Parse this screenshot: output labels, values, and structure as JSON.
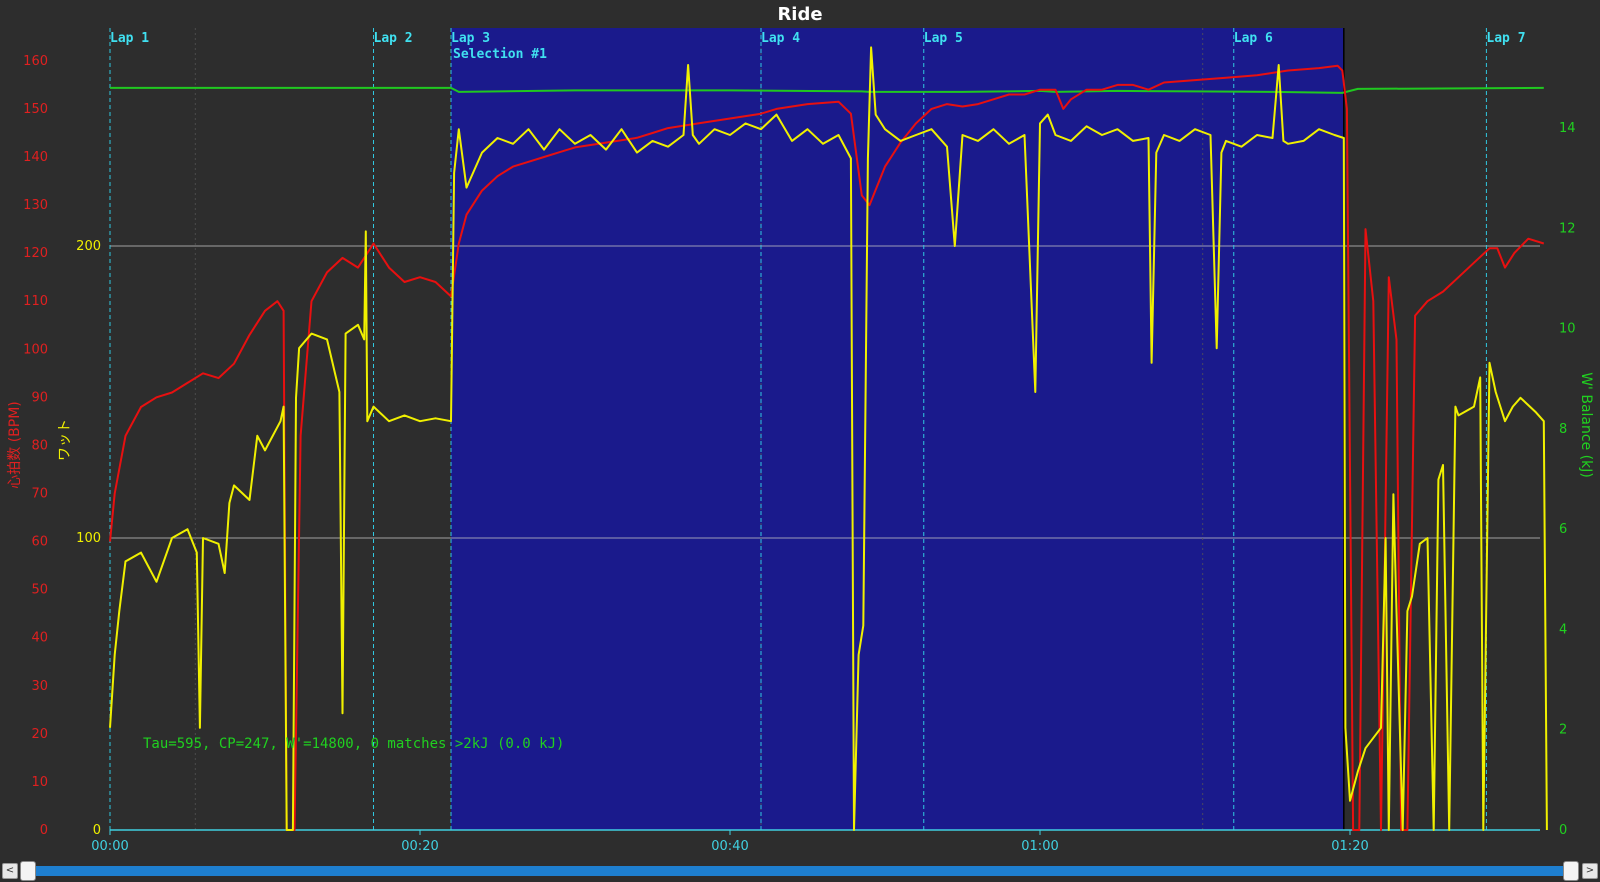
{
  "chart_data": {
    "type": "line",
    "title": "Ride",
    "left_axes": [
      {
        "name": "心拍数 (BPM)",
        "color": "#e02020",
        "ticks": [
          0,
          10,
          20,
          30,
          40,
          50,
          60,
          70,
          80,
          90,
          100,
          110,
          120,
          130,
          140,
          150,
          160
        ],
        "range": [
          0,
          166
        ]
      },
      {
        "name": "ワット",
        "color": "#f0f000",
        "ticks": [
          0,
          100,
          200
        ],
        "range": [
          0,
          275
        ]
      }
    ],
    "right_axis": {
      "name": "W' Balance (kJ)",
      "color": "#20d020",
      "ticks": [
        0,
        2,
        4,
        6,
        8,
        10,
        12,
        14
      ],
      "range": [
        0,
        15.2
      ]
    },
    "x_axis": {
      "ticks": [
        "00:00",
        "00:20",
        "00:40",
        "01:00",
        "01:20"
      ],
      "range_minutes": [
        0,
        92.5
      ]
    },
    "laps": [
      {
        "label": "Lap 1",
        "t": 0
      },
      {
        "label": "Lap 2",
        "t": 17
      },
      {
        "label": "Lap 3",
        "t": 22
      },
      {
        "label": "Lap 4",
        "t": 42
      },
      {
        "label": "Lap 5",
        "t": 52.5
      },
      {
        "label": "Lap 6",
        "t": 72.5
      },
      {
        "label": "Lap 7",
        "t": 88.8
      }
    ],
    "selection": {
      "label": "Selection #1",
      "start": 22,
      "end": 79.6
    },
    "annotation": "Tau=595, CP=247, W'=14800, 0 matches >2kJ (0.0 kJ)",
    "grid": "horizontal lines at 100 W and 200 W",
    "series": [
      {
        "name": "心拍数",
        "color": "#e81010",
        "axis": "hr",
        "points": [
          [
            0,
            60
          ],
          [
            0.3,
            70
          ],
          [
            1,
            82
          ],
          [
            2,
            88
          ],
          [
            3,
            90
          ],
          [
            4,
            91
          ],
          [
            5,
            93
          ],
          [
            6,
            95
          ],
          [
            7,
            94
          ],
          [
            8,
            97
          ],
          [
            9,
            103
          ],
          [
            10,
            108
          ],
          [
            10.8,
            110
          ],
          [
            11.2,
            108
          ],
          [
            11.4,
            0
          ],
          [
            11.9,
            0
          ],
          [
            12.3,
            82
          ],
          [
            13,
            110
          ],
          [
            14,
            116
          ],
          [
            15,
            119
          ],
          [
            16,
            117
          ],
          [
            17,
            122
          ],
          [
            18,
            117
          ],
          [
            19,
            114
          ],
          [
            20,
            115
          ],
          [
            21,
            114
          ],
          [
            22,
            111
          ],
          [
            22.5,
            122
          ],
          [
            23,
            128
          ],
          [
            24,
            133
          ],
          [
            25,
            136
          ],
          [
            26,
            138
          ],
          [
            27,
            139
          ],
          [
            28,
            140
          ],
          [
            29,
            141
          ],
          [
            30,
            142
          ],
          [
            32,
            143
          ],
          [
            34,
            144
          ],
          [
            35,
            145
          ],
          [
            36,
            146
          ],
          [
            38,
            147
          ],
          [
            40,
            148
          ],
          [
            42,
            149
          ],
          [
            43,
            150
          ],
          [
            45,
            151
          ],
          [
            47,
            151.5
          ],
          [
            47.8,
            149
          ],
          [
            48.5,
            132
          ],
          [
            49,
            130
          ],
          [
            50,
            138
          ],
          [
            51,
            143
          ],
          [
            52,
            147
          ],
          [
            53,
            150
          ],
          [
            54,
            151
          ],
          [
            55,
            150.5
          ],
          [
            56,
            151
          ],
          [
            57,
            152
          ],
          [
            58,
            153
          ],
          [
            59,
            153
          ],
          [
            60,
            154
          ],
          [
            61,
            154
          ],
          [
            61.5,
            150
          ],
          [
            62,
            152
          ],
          [
            63,
            154
          ],
          [
            64,
            154
          ],
          [
            65,
            155
          ],
          [
            66,
            155
          ],
          [
            67,
            154
          ],
          [
            68,
            155.5
          ],
          [
            70,
            156
          ],
          [
            72,
            156.5
          ],
          [
            74,
            157
          ],
          [
            76,
            158
          ],
          [
            78,
            158.5
          ],
          [
            79.2,
            159
          ],
          [
            79.5,
            158
          ],
          [
            79.8,
            150
          ],
          [
            80.2,
            0
          ],
          [
            80.6,
            0
          ],
          [
            81,
            125
          ],
          [
            81.5,
            110
          ],
          [
            82,
            0
          ],
          [
            82.5,
            115
          ],
          [
            83,
            102
          ],
          [
            83.3,
            0
          ],
          [
            83.7,
            0
          ],
          [
            84.2,
            107
          ],
          [
            85,
            110
          ],
          [
            86,
            112
          ],
          [
            87,
            115
          ],
          [
            88,
            118
          ],
          [
            89,
            121
          ],
          [
            89.5,
            121
          ],
          [
            90,
            117
          ],
          [
            90.6,
            120
          ],
          [
            91.5,
            123
          ],
          [
            92.5,
            122
          ]
        ]
      },
      {
        "name": "ワット",
        "color": "#f0f000",
        "axis": "w",
        "points": [
          [
            0,
            35
          ],
          [
            0.3,
            60
          ],
          [
            0.6,
            75
          ],
          [
            1,
            92
          ],
          [
            2,
            95
          ],
          [
            3,
            85
          ],
          [
            4,
            100
          ],
          [
            5,
            103
          ],
          [
            5.6,
            95
          ],
          [
            5.8,
            35
          ],
          [
            6,
            100
          ],
          [
            7,
            98
          ],
          [
            7.4,
            88
          ],
          [
            7.7,
            112
          ],
          [
            8,
            118
          ],
          [
            9,
            113
          ],
          [
            9.5,
            135
          ],
          [
            10,
            130
          ],
          [
            11,
            140
          ],
          [
            11.2,
            145
          ],
          [
            11.4,
            0
          ],
          [
            11.8,
            0
          ],
          [
            12,
            148
          ],
          [
            12.2,
            165
          ],
          [
            13,
            170
          ],
          [
            14,
            168
          ],
          [
            14.8,
            150
          ],
          [
            15,
            40
          ],
          [
            15.2,
            170
          ],
          [
            16,
            173
          ],
          [
            16.4,
            168
          ],
          [
            16.5,
            205
          ],
          [
            16.6,
            140
          ],
          [
            17,
            145
          ],
          [
            18,
            140
          ],
          [
            19,
            142
          ],
          [
            20,
            140
          ],
          [
            21,
            141
          ],
          [
            22,
            140
          ],
          [
            22.2,
            225
          ],
          [
            22.5,
            240
          ],
          [
            23,
            220
          ],
          [
            24,
            232
          ],
          [
            25,
            237
          ],
          [
            26,
            235
          ],
          [
            27,
            240
          ],
          [
            28,
            233
          ],
          [
            29,
            240
          ],
          [
            30,
            235
          ],
          [
            31,
            238
          ],
          [
            32,
            233
          ],
          [
            33,
            240
          ],
          [
            34,
            232
          ],
          [
            35,
            236
          ],
          [
            36,
            234
          ],
          [
            37,
            238
          ],
          [
            37.3,
            262
          ],
          [
            37.6,
            238
          ],
          [
            38,
            235
          ],
          [
            39,
            240
          ],
          [
            40,
            238
          ],
          [
            41,
            242
          ],
          [
            42,
            240
          ],
          [
            43,
            245
          ],
          [
            44,
            236
          ],
          [
            45,
            240
          ],
          [
            46,
            235
          ],
          [
            47,
            238
          ],
          [
            47.8,
            230
          ],
          [
            48,
            0
          ],
          [
            48.3,
            60
          ],
          [
            48.6,
            70
          ],
          [
            48.9,
            230
          ],
          [
            49.1,
            268
          ],
          [
            49.4,
            245
          ],
          [
            50,
            240
          ],
          [
            51,
            236
          ],
          [
            52,
            238
          ],
          [
            53,
            240
          ],
          [
            54,
            234
          ],
          [
            54.5,
            200
          ],
          [
            55,
            238
          ],
          [
            56,
            236
          ],
          [
            57,
            240
          ],
          [
            58,
            235
          ],
          [
            59,
            238
          ],
          [
            59.7,
            150
          ],
          [
            60,
            242
          ],
          [
            60.5,
            245
          ],
          [
            61,
            238
          ],
          [
            62,
            236
          ],
          [
            63,
            241
          ],
          [
            64,
            238
          ],
          [
            65,
            240
          ],
          [
            66,
            236
          ],
          [
            67,
            237
          ],
          [
            67.2,
            160
          ],
          [
            67.5,
            232
          ],
          [
            68,
            238
          ],
          [
            69,
            236
          ],
          [
            70,
            240
          ],
          [
            71,
            238
          ],
          [
            71.4,
            165
          ],
          [
            71.7,
            232
          ],
          [
            72,
            236
          ],
          [
            73,
            234
          ],
          [
            74,
            238
          ],
          [
            75,
            237
          ],
          [
            75.4,
            262
          ],
          [
            75.7,
            236
          ],
          [
            76,
            235
          ],
          [
            77,
            236
          ],
          [
            78,
            240
          ],
          [
            79,
            238
          ],
          [
            79.6,
            237
          ],
          [
            79.7,
            35
          ],
          [
            80,
            10
          ],
          [
            80.5,
            20
          ],
          [
            81,
            28
          ],
          [
            82,
            35
          ],
          [
            82.3,
            100
          ],
          [
            82.5,
            0
          ],
          [
            82.8,
            115
          ],
          [
            83,
            75
          ],
          [
            83.4,
            0
          ],
          [
            83.7,
            75
          ],
          [
            84,
            80
          ],
          [
            84.5,
            98
          ],
          [
            85,
            100
          ],
          [
            85.4,
            0
          ],
          [
            85.7,
            120
          ],
          [
            86,
            125
          ],
          [
            86.4,
            0
          ],
          [
            86.8,
            145
          ],
          [
            87,
            142
          ],
          [
            88,
            145
          ],
          [
            88.4,
            155
          ],
          [
            88.6,
            0
          ],
          [
            89,
            160
          ],
          [
            89.4,
            150
          ],
          [
            90,
            140
          ],
          [
            90.5,
            145
          ],
          [
            91,
            148
          ],
          [
            92,
            143
          ],
          [
            92.5,
            140
          ],
          [
            92.7,
            0
          ]
        ]
      },
      {
        "name": "W' Balance",
        "color": "#20c820",
        "axis": "g",
        "points": [
          [
            0,
            14.8
          ],
          [
            22,
            14.8
          ],
          [
            22.5,
            14.72
          ],
          [
            30,
            14.75
          ],
          [
            40,
            14.75
          ],
          [
            48.5,
            14.73
          ],
          [
            49,
            14.72
          ],
          [
            55,
            14.72
          ],
          [
            60,
            14.74
          ],
          [
            61,
            14.72
          ],
          [
            65,
            14.74
          ],
          [
            70,
            14.73
          ],
          [
            75,
            14.72
          ],
          [
            79.5,
            14.7
          ],
          [
            80.5,
            14.78
          ],
          [
            92.5,
            14.8
          ]
        ]
      }
    ]
  },
  "scrollbar": {
    "left_arrow": "<",
    "right_arrow": ">"
  }
}
